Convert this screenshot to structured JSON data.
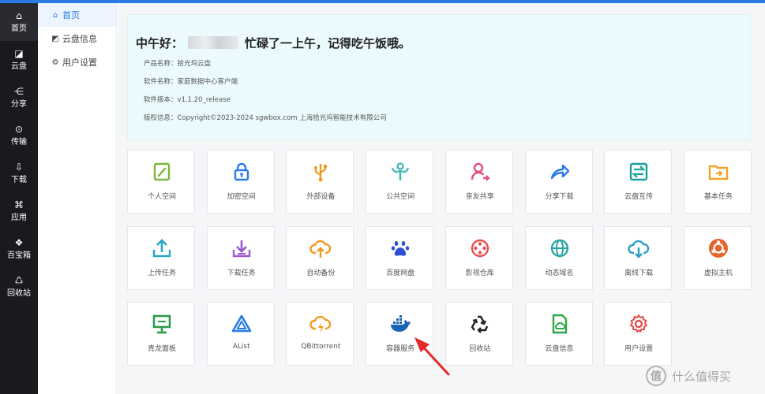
{
  "colors": {
    "accent": "#2a7be4",
    "nav_bg": "#191a1e",
    "info_bg": "#ebfbfd",
    "arrow": "#e02b2b"
  },
  "nav": [
    {
      "icon": "home-icon",
      "glyph": "⌂",
      "label": "首页",
      "active": true
    },
    {
      "icon": "cloud-disk-icon",
      "glyph": "◪",
      "label": "云盘"
    },
    {
      "icon": "share-icon",
      "glyph": "⋲",
      "label": "分享"
    },
    {
      "icon": "transfer-icon",
      "glyph": "⊙",
      "label": "传输"
    },
    {
      "icon": "download-icon",
      "glyph": "⇩",
      "label": "下载"
    },
    {
      "icon": "apps-icon",
      "glyph": "⌘",
      "label": "应用"
    },
    {
      "icon": "toolbox-icon",
      "glyph": "❖",
      "label": "百宝箱"
    },
    {
      "icon": "recycle-icon",
      "glyph": "♺",
      "label": "回收站"
    }
  ],
  "subnav": [
    {
      "icon": "home-icon",
      "glyph": "⌂",
      "label": "首页",
      "active": true
    },
    {
      "icon": "disk-info-icon",
      "glyph": "◩",
      "label": "云盘信息"
    },
    {
      "icon": "settings-icon",
      "glyph": "⚙",
      "label": "用户设置"
    }
  ],
  "greeting": {
    "prefix": "中午好：",
    "suffix": "忙碌了一上午，记得吃午饭哦。"
  },
  "info": [
    {
      "key": "产品名称：",
      "value": "拾光坞云盘"
    },
    {
      "key": "软件名称：",
      "value": "家庭数据中心客户端"
    },
    {
      "key": "软件版本：",
      "value": "v1.1.20_release"
    },
    {
      "key": "版权信息：",
      "value": "Copyright©2023-2024 sgwbox.com 上海拾光坞智能技术有限公司"
    }
  ],
  "tiles": [
    {
      "label": "个人空间",
      "icon": "personal-space-icon",
      "color": "#7cb63a"
    },
    {
      "label": "加密空间",
      "icon": "lock-icon",
      "color": "#2a7be4"
    },
    {
      "label": "外部设备",
      "icon": "usb-icon",
      "color": "#f29a1f"
    },
    {
      "label": "公共空间",
      "icon": "public-space-icon",
      "color": "#3cb6b6"
    },
    {
      "label": "亲友共享",
      "icon": "user-share-icon",
      "color": "#e64e7c"
    },
    {
      "label": "分享下载",
      "icon": "share-arrow-icon",
      "color": "#2a7be4"
    },
    {
      "label": "云盘互传",
      "icon": "exchange-icon",
      "color": "#1aa39a"
    },
    {
      "label": "基本任务",
      "icon": "task-folder-icon",
      "color": "#f3a32c"
    },
    {
      "label": "上传任务",
      "icon": "upload-icon",
      "color": "#2aa6c6"
    },
    {
      "label": "下载任务",
      "icon": "download-task-icon",
      "color": "#9b59d0"
    },
    {
      "label": "自动备份",
      "icon": "cloud-upload-icon",
      "color": "#f29a1f"
    },
    {
      "label": "百度网盘",
      "icon": "baidu-icon",
      "color": "#2b4fd6"
    },
    {
      "label": "影视仓库",
      "icon": "film-reel-icon",
      "color": "#e64e4e"
    },
    {
      "label": "动态域名",
      "icon": "globe-icon",
      "color": "#2aa6a6"
    },
    {
      "label": "离线下载",
      "icon": "cloud-download-icon",
      "color": "#2a9dc6"
    },
    {
      "label": "虚拟主机",
      "icon": "ubuntu-icon",
      "color": "#e5662c"
    },
    {
      "label": "青龙面板",
      "icon": "panel-icon",
      "color": "#2a9d4a"
    },
    {
      "label": "AList",
      "icon": "alist-icon",
      "color": "#2a7be4"
    },
    {
      "label": "QBittorrent",
      "icon": "lightning-cloud-icon",
      "color": "#f29a1f"
    },
    {
      "label": "容器服务",
      "icon": "docker-icon",
      "color": "#1d63b5"
    },
    {
      "label": "回收站",
      "icon": "recycle-icon",
      "color": "#222222"
    },
    {
      "label": "云盘信息",
      "icon": "disk-info-icon",
      "color": "#2ba84a"
    },
    {
      "label": "用户设置",
      "icon": "gear-icon",
      "color": "#e64e4e"
    }
  ],
  "watermark": {
    "badge": "值",
    "text": "什么值得买"
  }
}
